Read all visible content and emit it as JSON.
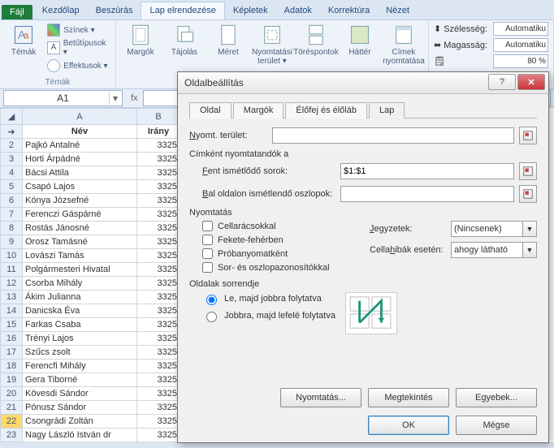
{
  "ribbon": {
    "file": "Fájl",
    "tabs": [
      "Kezdőlap",
      "Beszúrás",
      "Lap elrendezése",
      "Képletek",
      "Adatok",
      "Korrektúra",
      "Nézet"
    ],
    "activeTab": 2,
    "groups": {
      "themes": {
        "temak": "Témák",
        "szinek": "Színek ▾",
        "betut": "Betűtípusok ▾",
        "effekt": "Effektusok ▾",
        "label": "Témák"
      },
      "page": {
        "margok": "Margók",
        "tajolas": "Tájolás",
        "meret": "Méret",
        "nyomtat": "Nyomtatási terület ▾",
        "tores": "Töréspontok",
        "hatter": "Háttér",
        "cimek": "Címek nyomtatása"
      },
      "fit": {
        "szel_lbl": "Szélesség:",
        "mag_lbl": "Magasság:",
        "szel_val": "Automatiku",
        "mag_val": "Automatiku",
        "scale_lbl": "",
        "scale_val": "80 %"
      }
    }
  },
  "namebox": "A1",
  "columns": [
    "A",
    "B"
  ],
  "headers": {
    "name": "Név",
    "irany": "Irány"
  },
  "rows": [
    {
      "n": 2,
      "name": "Pajkó Antalné",
      "v": "3325"
    },
    {
      "n": 3,
      "name": "Horti Árpádné",
      "v": "3325"
    },
    {
      "n": 4,
      "name": "Bácsi Attila",
      "v": "3325"
    },
    {
      "n": 5,
      "name": "Csapó Lajos",
      "v": "3325"
    },
    {
      "n": 6,
      "name": "Kónya Józsefné",
      "v": "3325"
    },
    {
      "n": 7,
      "name": "Ferenczi Gáspárné",
      "v": "3325"
    },
    {
      "n": 8,
      "name": "Rostás Jánosné",
      "v": "3325"
    },
    {
      "n": 9,
      "name": "Orosz Tamásné",
      "v": "3325"
    },
    {
      "n": 10,
      "name": "Lovászi Tamás",
      "v": "3325"
    },
    {
      "n": 11,
      "name": "Polgármesteri Hivatal",
      "v": "3325"
    },
    {
      "n": 12,
      "name": "Csorba Mihály",
      "v": "3325"
    },
    {
      "n": 13,
      "name": "Ákim Julianna",
      "v": "3325"
    },
    {
      "n": 14,
      "name": "Danicska Éva",
      "v": "3325"
    },
    {
      "n": 15,
      "name": "Farkas Csaba",
      "v": "3325"
    },
    {
      "n": 16,
      "name": "Trényi Lajos",
      "v": "3325"
    },
    {
      "n": 17,
      "name": "Szűcs zsolt",
      "v": "3325"
    },
    {
      "n": 18,
      "name": "Ferencfi Mihály",
      "v": "3325"
    },
    {
      "n": 19,
      "name": "Gera Tiborné",
      "v": "3325"
    },
    {
      "n": 20,
      "name": "Kövesdi Sándor",
      "v": "3325"
    },
    {
      "n": 21,
      "name": "Pónusz Sándor",
      "v": "3325"
    },
    {
      "n": 22,
      "name": "Csongrádi Zoltán",
      "v": "3325",
      "hl": true
    },
    {
      "n": 23,
      "name": "Nagy László István dr",
      "v": "3325"
    }
  ],
  "dialog": {
    "title": "Oldalbeállítás",
    "tabs": [
      "Oldal",
      "Margók",
      "Élőfej és élőláb",
      "Lap"
    ],
    "activeTab": 3,
    "print_area_lbl": "Nyomt. terület:",
    "print_area_val": "",
    "titles_lbl": "Címként nyomtatandók a",
    "rows_lbl": "Fent ismétlődő sorok:",
    "rows_val": "$1:$1",
    "cols_lbl": "Bal oldalon ismétlendő oszlopok:",
    "cols_val": "",
    "print_grp": "Nyomtatás",
    "chk_grid": "Cellarácsokkal",
    "chk_bw": "Fekete-fehérben",
    "chk_draft": "Próbanyomatként",
    "chk_headings": "Sor- és oszlopazonosítókkal",
    "notes_lbl": "Jegyzetek:",
    "notes_val": "(Nincsenek)",
    "errors_lbl": "Cellahibák esetén:",
    "errors_val": "ahogy látható",
    "order_lbl": "Oldalak sorrendje",
    "order_down": "Le, majd jobbra folytatva",
    "order_over": "Jobbra, majd lefelé folytatva",
    "btn_print": "Nyomtatás...",
    "btn_preview": "Megtekintés",
    "btn_options": "Egyebek...",
    "btn_ok": "OK",
    "btn_cancel": "Mégse"
  }
}
